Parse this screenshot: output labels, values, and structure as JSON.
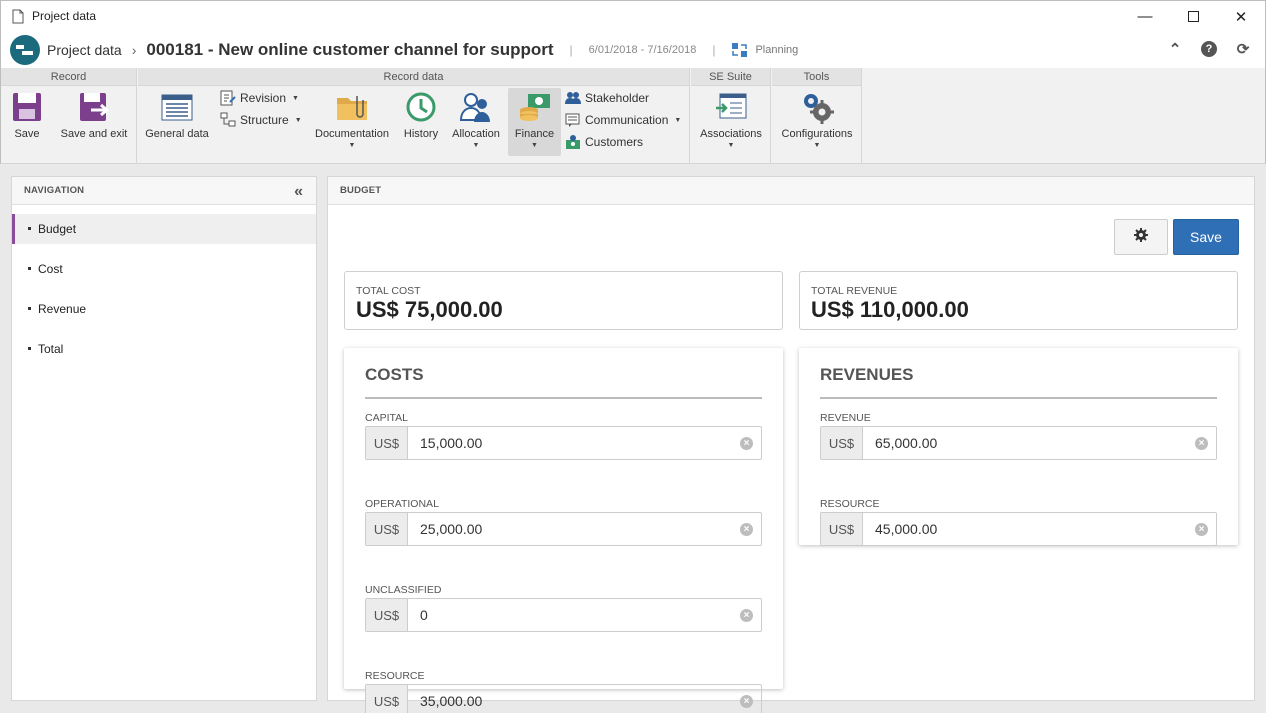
{
  "window": {
    "title": "Project data"
  },
  "header": {
    "app_name": "Project data",
    "separator": "›",
    "record_title": "000181 - New online customer channel for support",
    "divider": "|",
    "dates": "6/01/2018 - 7/16/2018",
    "phase": "Planning"
  },
  "ribbon": {
    "groups": {
      "record": "Record",
      "record_data": "Record data",
      "se_suite": "SE Suite",
      "tools": "Tools"
    },
    "buttons": {
      "save": "Save",
      "save_exit": "Save and exit",
      "general_data": "General data",
      "revision": "Revision",
      "structure": "Structure",
      "documentation": "Documentation",
      "history": "History",
      "allocation": "Allocation",
      "finance": "Finance",
      "stakeholder": "Stakeholder",
      "communication": "Communication",
      "customers": "Customers",
      "associations": "Associations",
      "configurations": "Configurations"
    }
  },
  "navigation": {
    "title": "NAVIGATION",
    "items": [
      "Budget",
      "Cost",
      "Revenue",
      "Total"
    ]
  },
  "budget": {
    "title": "BUDGET",
    "save_label": "Save",
    "total_cost_label": "TOTAL COST",
    "total_cost_value": "US$ 75,000.00",
    "total_revenue_label": "TOTAL REVENUE",
    "total_revenue_value": "US$ 110,000.00",
    "costs": {
      "title": "COSTS",
      "fields": [
        {
          "label": "CAPITAL",
          "prefix": "US$",
          "value": "15,000.00"
        },
        {
          "label": "OPERATIONAL",
          "prefix": "US$",
          "value": "25,000.00"
        },
        {
          "label": "UNCLASSIFIED",
          "prefix": "US$",
          "value": "0"
        },
        {
          "label": "RESOURCE",
          "prefix": "US$",
          "value": "35,000.00"
        }
      ]
    },
    "revenues": {
      "title": "REVENUES",
      "fields": [
        {
          "label": "REVENUE",
          "prefix": "US$",
          "value": "65,000.00"
        },
        {
          "label": "RESOURCE",
          "prefix": "US$",
          "value": "45,000.00"
        }
      ]
    }
  },
  "colors": {
    "accent": "#2f6fb6",
    "nav_selected": "#8b4c9b",
    "logo": "#1b6a7d"
  }
}
